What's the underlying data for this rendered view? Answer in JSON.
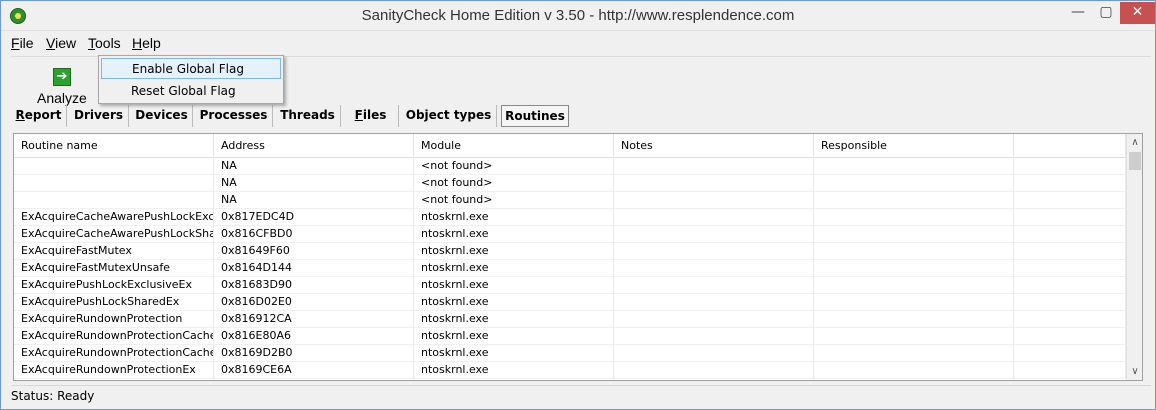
{
  "window": {
    "title": "SanityCheck Home Edition  v 3.50   -   http://www.resplendence.com",
    "minimize": "—",
    "maximize": "▢",
    "close": "✕"
  },
  "menu": {
    "file": {
      "accel": "F",
      "rest": "ile"
    },
    "view": {
      "accel": "V",
      "rest": "iew"
    },
    "tools": {
      "accel": "T",
      "rest": "ools"
    },
    "help": {
      "accel": "H",
      "rest": "elp"
    }
  },
  "tools_menu": {
    "items": [
      "Enable Global Flag",
      "Reset Global Flag"
    ]
  },
  "toolbar": {
    "analyze_label": "Analyze",
    "analyze_icon": "➔"
  },
  "tabs": {
    "report": {
      "accel": "R",
      "rest": "eport"
    },
    "drivers": "Drivers",
    "devices": "Devices",
    "processes": "Processes",
    "threads": "Threads",
    "files": {
      "accel": "F",
      "rest": "iles"
    },
    "object_types": "Object types",
    "routines": "Routines"
  },
  "table": {
    "headers": [
      "Routine name",
      "Address",
      "Module",
      "Notes",
      "Responsible",
      ""
    ],
    "rows": [
      [
        "",
        "NA",
        "<not found>",
        "",
        "",
        ""
      ],
      [
        "",
        "NA",
        "<not found>",
        "",
        "",
        ""
      ],
      [
        "",
        "NA",
        "<not found>",
        "",
        "",
        ""
      ],
      [
        "ExAcquireCacheAwarePushLockExclu...",
        "0x817EDC4D",
        "ntoskrnl.exe",
        "",
        "",
        ""
      ],
      [
        "ExAcquireCacheAwarePushLockShar...",
        "0x816CFBD0",
        "ntoskrnl.exe",
        "",
        "",
        ""
      ],
      [
        "ExAcquireFastMutex",
        "0x81649F60",
        "ntoskrnl.exe",
        "",
        "",
        ""
      ],
      [
        "ExAcquireFastMutexUnsafe",
        "0x8164D144",
        "ntoskrnl.exe",
        "",
        "",
        ""
      ],
      [
        "ExAcquirePushLockExclusiveEx",
        "0x81683D90",
        "ntoskrnl.exe",
        "",
        "",
        ""
      ],
      [
        "ExAcquirePushLockSharedEx",
        "0x816D02E0",
        "ntoskrnl.exe",
        "",
        "",
        ""
      ],
      [
        "ExAcquireRundownProtection",
        "0x816912CA",
        "ntoskrnl.exe",
        "",
        "",
        ""
      ],
      [
        "ExAcquireRundownProtectionCache...",
        "0x816E80A6",
        "ntoskrnl.exe",
        "",
        "",
        ""
      ],
      [
        "ExAcquireRundownProtectionCache...",
        "0x8169D2B0",
        "ntoskrnl.exe",
        "",
        "",
        ""
      ],
      [
        "ExAcquireRundownProtectionEx",
        "0x8169CE6A",
        "ntoskrnl.exe",
        "",
        "",
        ""
      ]
    ]
  },
  "scroll": {
    "up": "∧",
    "down": "∨"
  },
  "status": {
    "text": "Status: Ready"
  },
  "colors": {
    "accent_close": "#c75050",
    "highlight": "#e5f1fb",
    "icon_green": "#2ea02e"
  }
}
